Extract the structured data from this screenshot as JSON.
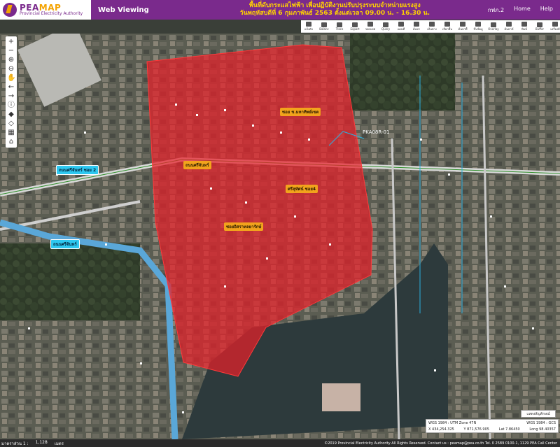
{
  "header": {
    "logo_main": "PEA",
    "logo_main2": "MAP",
    "logo_sub": "Provincial Electricity Authority",
    "app_title": "Web Viewing",
    "notice_line1": "พื้นที่ดับกระแสไฟฟ้า เพื่อปฏิบัติงานปรับปรุงระบบจำหน่ายแรงสูง",
    "notice_line2": "วันพฤหัสบดีที่ 6 กุมภาพันธ์ 2563 ตั้งแต่เวลา 09.00 น. - 16.30 น.",
    "nav": [
      "กฟภ.2",
      "Home",
      "Help"
    ]
  },
  "toolbar": {
    "tools": [
      "แจ้งดับ",
      "Balanc",
      "Trace",
      "Export",
      "ขอบเขต",
      "Query",
      "แผนที่",
      "ค้นหา",
      "เส้นทาง",
      "เลือกพื้น",
      "ค้นหาพื้",
      "ชั้นข้อมู",
      "Overlay",
      "ค้นหาข้",
      "พิมพ์",
      "Buffer",
      "เครื่องมื"
    ]
  },
  "map": {
    "road_labels": [
      {
        "text": "ถนนศรีจันทร์ ซอย 2",
        "style": "cyan"
      },
      {
        "text": "ถนนศรีจันทร์",
        "style": "cyan"
      },
      {
        "text": "ถนนศรีจันทร์",
        "style": "orange"
      },
      {
        "text": "ซอย ช.มหาทิพย์เขต",
        "style": "orange"
      },
      {
        "text": "ศรีสุทัศน์ ซอย4",
        "style": "orange"
      },
      {
        "text": "ซอยอิสราหลยารักษ์",
        "style": "orange"
      }
    ],
    "pka_label": "PKA08R-01",
    "outage_color": "#e8202a",
    "water_color": "#2f3a3f"
  },
  "controls": [
    "+",
    "−",
    "⊕",
    "⊖",
    "✋",
    "←",
    "→",
    "ⓘ",
    "◆",
    "◇",
    "▦",
    "⌂"
  ],
  "bottom": {
    "legend_button": "แสดงสัญลักษณ์",
    "coord_row1": [
      "WGS 1984 : UTM Zone 47N",
      "WGS 1984 : GCS"
    ],
    "coord_row2": [
      "X 434,254.325",
      "Y 871,576.905",
      "Lat 7.86450",
      "Long 98.40357"
    ],
    "scale_label": "มาตราส่วน 1 :",
    "scale_value": "1,128",
    "scale_unit": "เมตร",
    "copyright": "©2019 Provincial Electricity Authority All Rights Reserved. Contact us : peamap@pea.co.th Tel. 0 2589 0100-1, 1129 PEA Call Center"
  }
}
